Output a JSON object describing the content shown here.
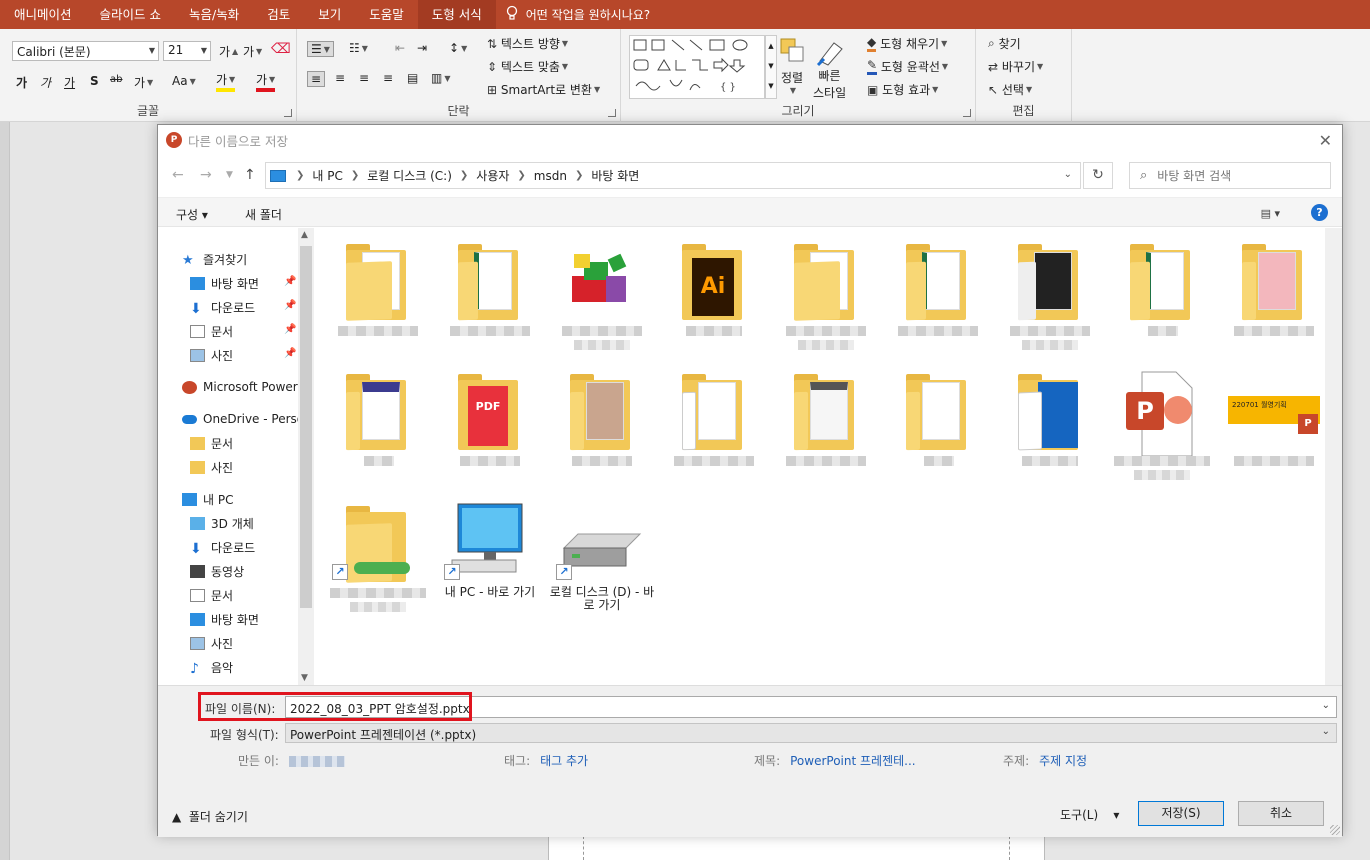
{
  "ribbon": {
    "tabs": [
      "애니메이션",
      "슬라이드 쇼",
      "녹음/녹화",
      "검토",
      "보기",
      "도움말",
      "도형 서식"
    ],
    "active_tab": "도형 서식",
    "tell_me": "어떤 작업을 원하시나요?",
    "font_name": "Calibri (본문)",
    "font_size": "21",
    "groups": {
      "font": "글꼴",
      "paragraph": "단락",
      "drawing": "그리기",
      "editing": "편집"
    },
    "text_direction": "텍스트 방향",
    "align_text": "텍스트 맞춤",
    "smartart": "SmartArt로 변환",
    "arrange": "정렬",
    "quick_styles_1": "빠른",
    "quick_styles_2": "스타일",
    "shape_fill": "도형 채우기",
    "shape_outline": "도형 윤곽선",
    "shape_effects": "도형 효과",
    "find": "찾기",
    "replace": "바꾸기",
    "select": "선택",
    "font_buttons": [
      "가",
      "가",
      "가",
      "S",
      "ab",
      "가",
      "Aa",
      "가",
      "가"
    ]
  },
  "dialog": {
    "title": "다른 이름으로 저장",
    "address": [
      "내 PC",
      "로컬 디스크 (C:)",
      "사용자",
      "msdn",
      "바탕 화면"
    ],
    "search_placeholder": "바탕 화면 검색",
    "organize": "구성",
    "new_folder": "새 폴더",
    "nav": {
      "quick_access": "즐겨찾기",
      "qa_items": [
        "바탕 화면",
        "다운로드",
        "문서",
        "사진"
      ],
      "ms_ppt": "Microsoft PowerP",
      "onedrive": "OneDrive - Perso",
      "onedrive_items": [
        "문서",
        "사진"
      ],
      "this_pc": "내 PC",
      "pc_items": [
        "3D 개체",
        "다운로드",
        "동영상",
        "문서",
        "바탕 화면",
        "사진",
        "음악"
      ]
    },
    "files": {
      "this_pc_shortcut": "내 PC - 바로 가기",
      "local_d_shortcut": "로컬 디스크 (D) - 바로 가기",
      "thumb_text": "220701 월영기획"
    },
    "form": {
      "filename_label": "파일 이름(N):",
      "filename_value": "2022_08_03_PPT 암호설정.pptx",
      "filetype_label": "파일 형식(T):",
      "filetype_value": "PowerPoint 프레젠테이션 (*.pptx)",
      "author_label": "만든 이:",
      "tags_label": "태그:",
      "tags_value": "태그 추가",
      "title_label": "제목:",
      "title_value": "PowerPoint 프레젠테...",
      "subject_label": "주제:",
      "subject_value": "주제 지정"
    },
    "hide_folders": "폴더 숨기기",
    "tools": "도구(L)",
    "save": "저장(S)",
    "cancel": "취소"
  }
}
